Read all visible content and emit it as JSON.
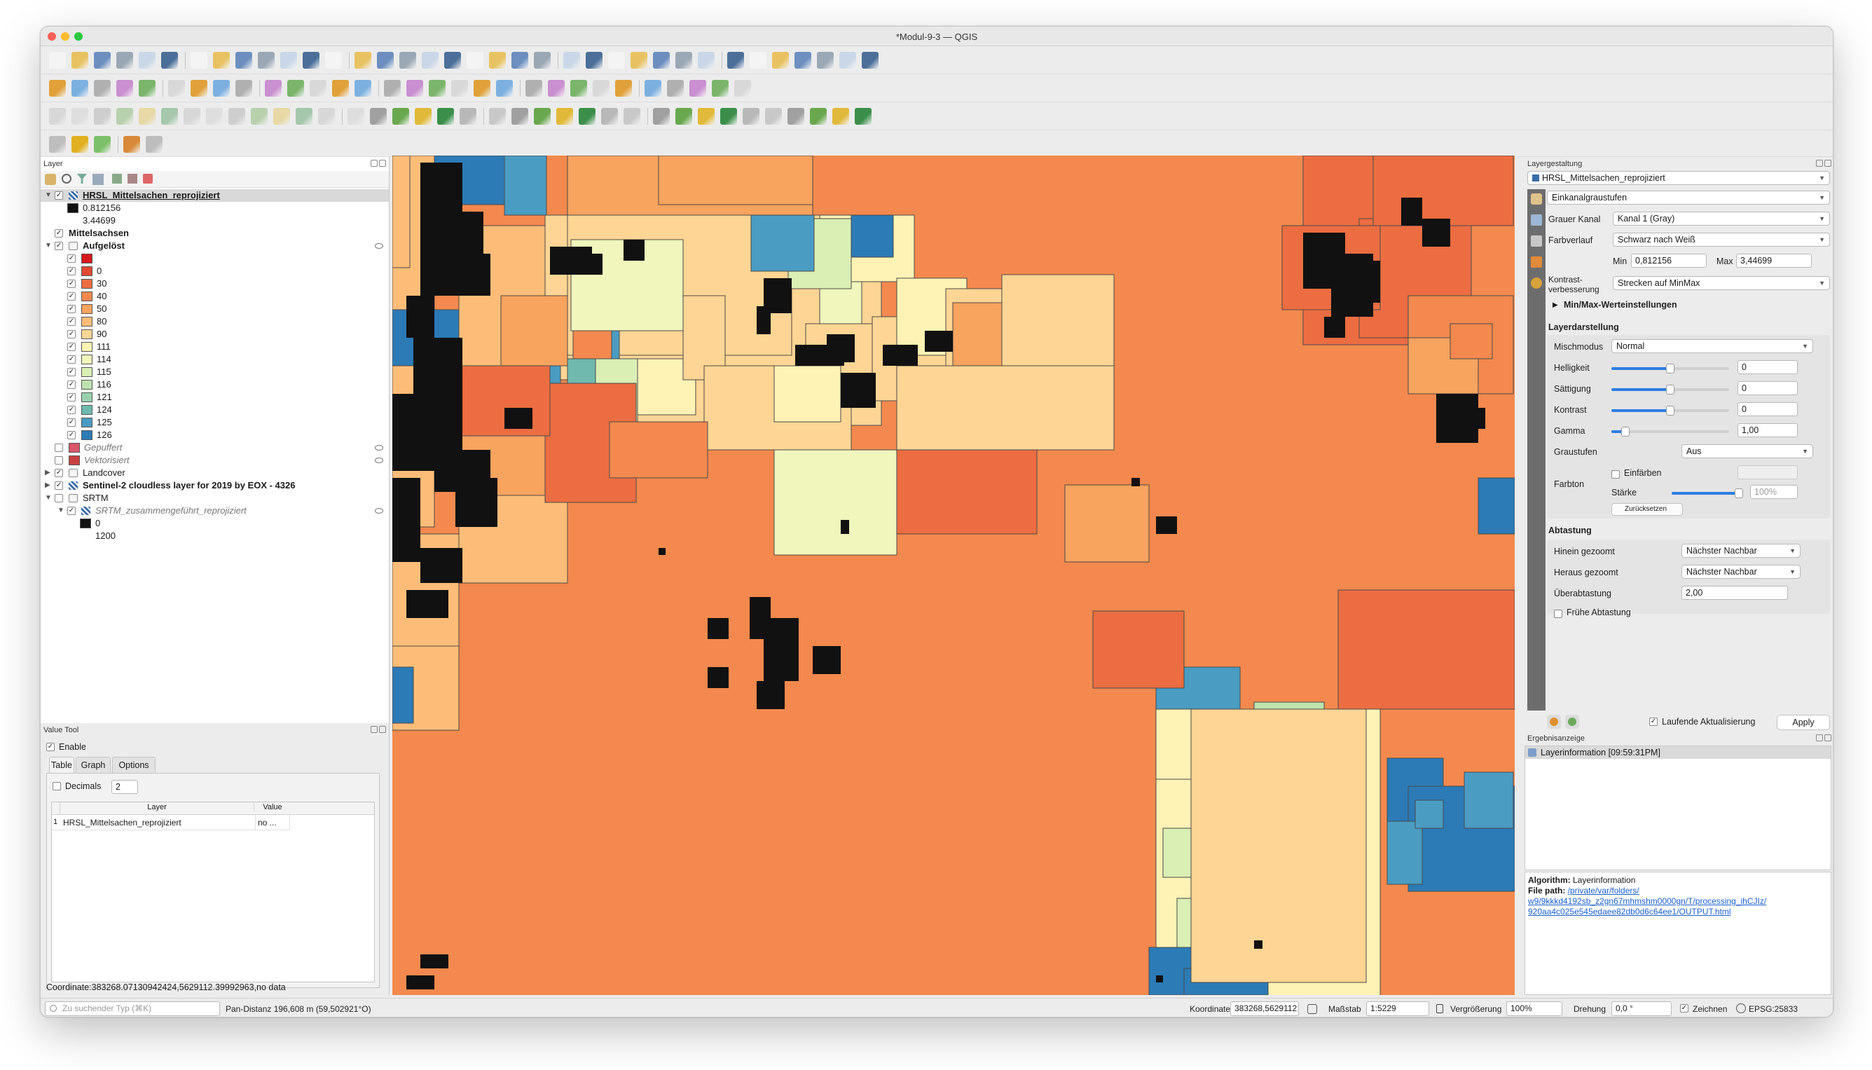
{
  "window": {
    "title": "*Modul-9-3 — QGIS"
  },
  "layer_panel": {
    "title": "Layer",
    "items": [
      {
        "label": "HRSL_Mittelsachen_reprojiziert",
        "checked": true,
        "bold": true,
        "underline": true
      },
      {
        "label": "0.812156"
      },
      {
        "label": "3.44699"
      },
      {
        "label": "Mittelsachsen",
        "checked": true,
        "bold": true
      },
      {
        "label": "Aufgelöst",
        "checked": true,
        "bold": true
      },
      {
        "label": "",
        "color": "#d7191c"
      },
      {
        "label": "0",
        "color": "#e34a33"
      },
      {
        "label": "30",
        "color": "#ec6d41"
      },
      {
        "label": "40",
        "color": "#f3894e"
      },
      {
        "label": "50",
        "color": "#f8a35e"
      },
      {
        "label": "80",
        "color": "#fdbd78"
      },
      {
        "label": "90",
        "color": "#fed594"
      },
      {
        "label": "111",
        "color": "#fef2b5"
      },
      {
        "label": "114",
        "color": "#f0f6bc"
      },
      {
        "label": "115",
        "color": "#d9efb4"
      },
      {
        "label": "116",
        "color": "#bce3ae"
      },
      {
        "label": "121",
        "color": "#98d2ac"
      },
      {
        "label": "124",
        "color": "#6fb9ae"
      },
      {
        "label": "125",
        "color": "#4b9cc2"
      },
      {
        "label": "126",
        "color": "#2c7bb6"
      },
      {
        "label": "Gepuffert",
        "checked": false,
        "italic": true
      },
      {
        "label": "Vektorisiert",
        "checked": false,
        "italic": true
      },
      {
        "label": "Landcover",
        "checked": true
      },
      {
        "label": "Sentinel-2 cloudless layer for 2019 by EOX - 4326",
        "checked": true,
        "bold": true
      },
      {
        "label": "SRTM",
        "checked": false
      },
      {
        "label": "SRTM_zusammengeführt_reprojiziert",
        "checked": true,
        "italic": true
      },
      {
        "label": "0"
      },
      {
        "label": "1200"
      }
    ]
  },
  "value_tool": {
    "title": "Value Tool",
    "enable_label": "Enable",
    "tabs": [
      "Table",
      "Graph",
      "Options"
    ],
    "decimals_label": "Decimals",
    "decimals_value": "2",
    "columns": [
      "Layer",
      "Value"
    ],
    "rows": [
      {
        "index": "1",
        "layer": "HRSL_Mittelsachen_reprojiziert",
        "value": "no ..."
      }
    ],
    "coordinate_text": "Coordinate:383268.07130942424,5629112.39992963,no data"
  },
  "layer_styling": {
    "title": "Layergestaltung",
    "layer": "HRSL_Mittelsachen_reprojiziert",
    "render_type": "Einkanalgraustufen",
    "gray_band_label": "Grauer Kanal",
    "gray_band": "Kanal 1 (Gray)",
    "gradient_label": "Farbverlauf",
    "gradient": "Schwarz nach Weiß",
    "min_label": "Min",
    "min": "0,812156",
    "max_label": "Max",
    "max": "3,44699",
    "contrast_label_1": "Kontrast-",
    "contrast_label_2": "verbesserung",
    "contrast": "Strecken auf MinMax",
    "minmax_label": "Min/Max-Werteinstellungen",
    "layer_render_title": "Layerdarstellung",
    "blend_label": "Mischmodus",
    "blend": "Normal",
    "brightness_label": "Helligkeit",
    "brightness": "0",
    "saturation_label": "Sättigung",
    "saturation": "0",
    "contrast2_label": "Kontrast",
    "contrast2": "0",
    "gamma_label": "Gamma",
    "gamma": "1,00",
    "grayscale_label": "Graustufen",
    "grayscale": "Aus",
    "colorize_label": "Einfärben",
    "hue_label": "Farbton",
    "strength_label": "Stärke",
    "strength": "100%",
    "reset_label": "Zurücksetzen",
    "resampling_title": "Abtastung",
    "zoomed_in_label": "Hinein gezoomt",
    "zoomed_in": "Nächster Nachbar",
    "zoomed_out_label": "Heraus gezoomt",
    "zoomed_out": "Nächster Nachbar",
    "oversampling_label": "Überabtastung",
    "oversampling": "2,00",
    "early_resampling_label": "Frühe Abtastung",
    "live_update_label": "Laufende Aktualisierung",
    "apply_label": "Apply"
  },
  "results": {
    "title": "Ergebnisanzeige",
    "item": "Layerinformation [09:59:31PM]",
    "algorithm_label": "Algorithm:",
    "algorithm": "Layerinformation",
    "filepath_label": "File path:",
    "filepath_1": "/private/var/folders/",
    "filepath_2": "w9/9kkkd4192sb_z2gn67mhmshm0000gn/T/processing_ihCJIz/",
    "filepath_3": "920aa4c025e545edaee82db0d6c64ee1/OUTPUT.html"
  },
  "statusbar": {
    "search_placeholder": "Zu suchender Typ (⌘K)",
    "pan_distance": "Pan-Distanz 196,608 m (59,502921°O)",
    "coord_label": "Koordinate",
    "coord": "383268,5629112",
    "scale_label": "Maßstab",
    "scale": "1:5229",
    "magnifier_label": "Vergrößerung",
    "magnifier": "100%",
    "rotation_label": "Drehung",
    "rotation": "0,0 °",
    "render_label": "Zeichnen",
    "crs": "EPSG:25833"
  },
  "colors": {
    "accent": "#2f7de1",
    "link": "#1a5fd0"
  }
}
